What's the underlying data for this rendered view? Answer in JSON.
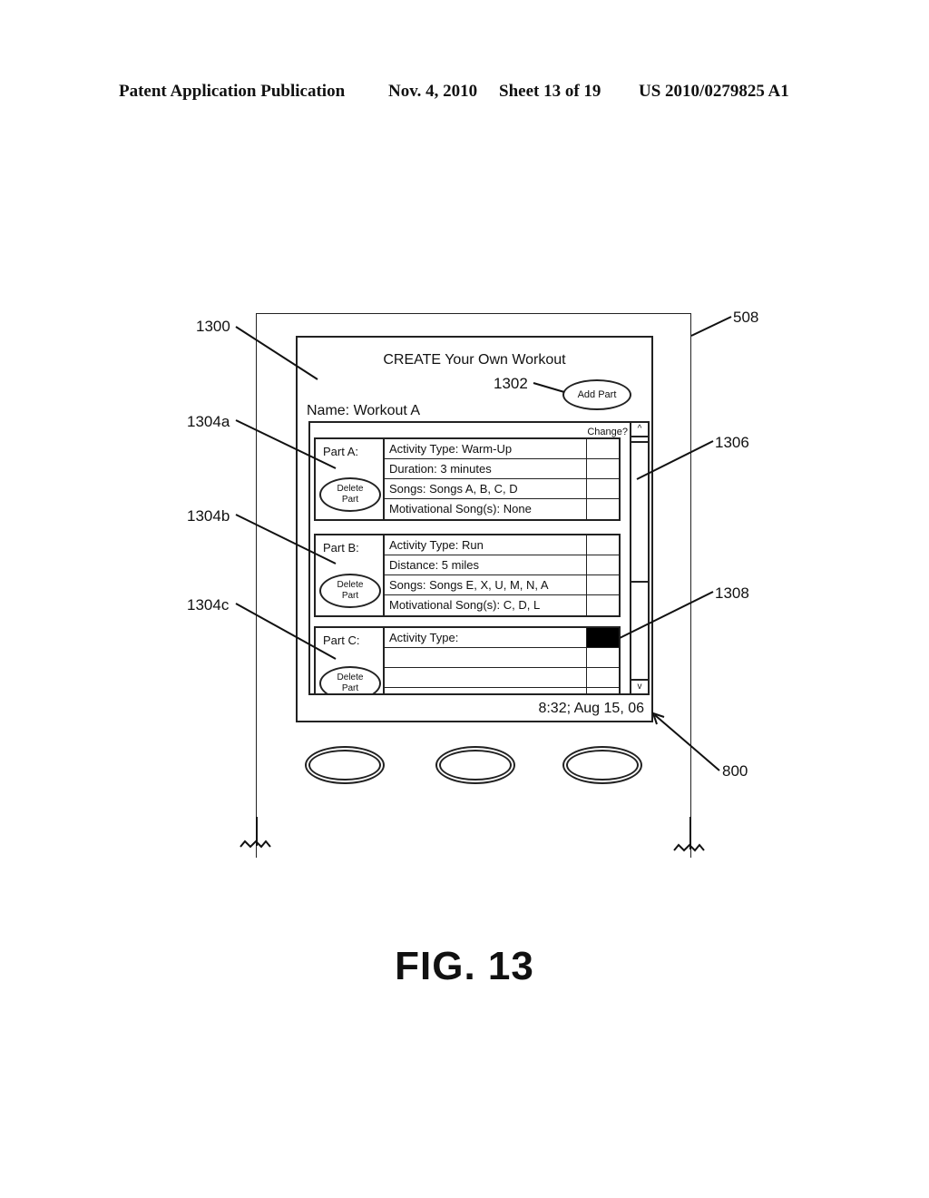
{
  "header": {
    "publication": "Patent Application Publication",
    "date": "Nov. 4, 2010",
    "sheet": "Sheet 13 of 19",
    "number": "US 2010/0279825 A1"
  },
  "screen": {
    "title": "CREATE Your Own Workout",
    "add_part_label": "Add Part",
    "name_label": "Name:  Workout A",
    "change_label": "Change?",
    "scroll_up": "^",
    "scroll_down": "v",
    "timestamp": "8:32; Aug 15, 06",
    "parts": [
      {
        "label": "Part A:",
        "delete_label_1": "Delete",
        "delete_label_2": "Part",
        "fields": [
          {
            "text": "Activity Type: Warm-Up",
            "selected": false
          },
          {
            "text": "Duration:  3 minutes",
            "selected": false
          },
          {
            "text": "Songs:  Songs A, B, C, D",
            "selected": false
          },
          {
            "text": "Motivational Song(s):  None",
            "selected": false
          }
        ]
      },
      {
        "label": "Part B:",
        "delete_label_1": "Delete",
        "delete_label_2": "Part",
        "fields": [
          {
            "text": "Activity Type: Run",
            "selected": false
          },
          {
            "text": "Distance:  5 miles",
            "selected": false
          },
          {
            "text": "Songs:  Songs E, X, U, M, N, A",
            "selected": false
          },
          {
            "text": "Motivational Song(s):  C, D, L",
            "selected": false
          }
        ]
      },
      {
        "label": "Part C:",
        "delete_label_1": "Delete",
        "delete_label_2": "Part",
        "fields": [
          {
            "text": "Activity Type:",
            "selected": true
          },
          {
            "text": "",
            "selected": false
          },
          {
            "text": "",
            "selected": false
          },
          {
            "text": "",
            "selected": false
          }
        ]
      }
    ],
    "scroll_position": 0.0
  },
  "hardware_buttons": 3,
  "reference_numerals": {
    "r1300": "1300",
    "r1302": "1302",
    "r1304a": "1304a",
    "r1304b": "1304b",
    "r1304c": "1304c",
    "r508": "508",
    "r1306": "1306",
    "r1308": "1308",
    "r800": "800"
  },
  "figure_label": "FIG.  13"
}
